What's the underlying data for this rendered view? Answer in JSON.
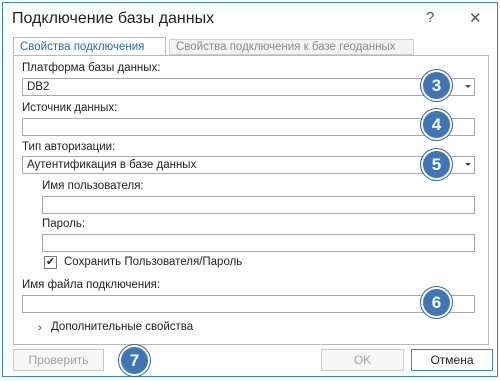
{
  "window": {
    "title": "Подключение базы данных",
    "help_glyph": "?",
    "close_glyph": "✕"
  },
  "tabs": [
    {
      "label": "Свойства подключения"
    },
    {
      "label": "Свойства подключения к базе геоданных"
    }
  ],
  "form": {
    "platform_label": "Платформа базы данных:",
    "platform_value": "DB2",
    "source_label": "Источник данных:",
    "source_value": "",
    "auth_label": "Тип авторизации:",
    "auth_value": "Аутентификация в базе данных",
    "username_label": "Имя пользователя:",
    "username_value": "",
    "password_label": "Пароль:",
    "password_value": "",
    "save_checkbox_label": "Сохранить Пользователя/Пароль",
    "save_checked": true,
    "filename_label": "Имя файла подключения:",
    "filename_value": "",
    "advanced_label": "Дополнительные свойства"
  },
  "badges": [
    "3",
    "4",
    "5",
    "6",
    "7"
  ],
  "buttons": {
    "verify": "Проверить",
    "ok": "OK",
    "cancel": "Отмена"
  },
  "colors": {
    "accent": "#1d6fb8",
    "badge": "#3f76b7"
  }
}
